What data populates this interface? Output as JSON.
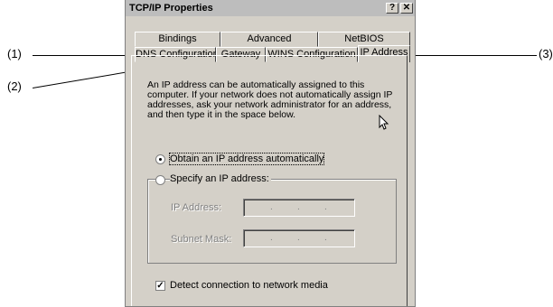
{
  "window": {
    "title": "TCP/IP Properties",
    "help_btn": "?",
    "close_btn": "✕"
  },
  "tabs_back": [
    "Bindings",
    "Advanced",
    "NetBIOS"
  ],
  "tabs_front": [
    "DNS Configuration",
    "Gateway",
    "WINS Configuration",
    "IP Address"
  ],
  "description": "An IP address can be automatically assigned to this computer. If your network does not automatically assign IP addresses, ask your network administrator for an address, and then type it in the space below.",
  "options": {
    "obtain_auto": "Obtain an IP address automatically",
    "specify": "Specify an IP address:",
    "selected": "obtain_auto"
  },
  "fields": {
    "ip_label": "IP Address:",
    "mask_label": "Subnet Mask:",
    "dot": "."
  },
  "detect": {
    "label": "Detect connection to network media",
    "checked": true,
    "mark": "✓"
  },
  "callouts": {
    "c1": "(1)",
    "c2": "(2)",
    "c3": "(3)"
  }
}
